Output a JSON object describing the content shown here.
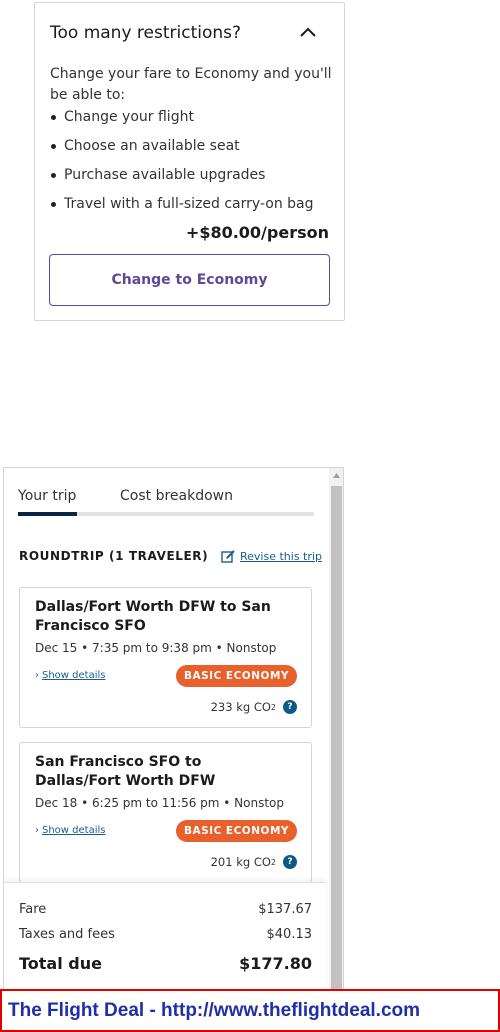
{
  "upsell": {
    "title": "Too many restrictions?",
    "description": "Change your fare to Economy and you'll be able to:",
    "benefits": [
      "Change your flight",
      "Choose an available seat",
      "Purchase available upgrades",
      "Travel with a full-sized carry-on bag"
    ],
    "price": "+$80.00/person",
    "button_label": "Change to Economy",
    "toggle_icon": "chevron-up-icon"
  },
  "trip": {
    "tabs": [
      {
        "label": "Your trip",
        "active": true
      },
      {
        "label": "Cost breakdown",
        "active": false
      }
    ],
    "heading": "ROUNDTRIP (1 TRAVELER)",
    "revise_label": "Revise this trip",
    "revise_icon": "edit-icon",
    "flights": [
      {
        "route": "Dallas/Fort Worth DFW to San Francisco SFO",
        "schedule": "Dec 15 • 7:35 pm to 9:38 pm • Nonstop",
        "details_label": "Show details",
        "badge": "BASIC ECONOMY",
        "co2_value": "233 kg CO",
        "co2_sub": "2"
      },
      {
        "route": "San Francisco SFO to Dallas/Fort Worth DFW",
        "schedule": "Dec 18 • 6:25 pm to 11:56 pm • Nonstop",
        "details_label": "Show details",
        "badge": "BASIC ECONOMY",
        "co2_value": "201 kg CO",
        "co2_sub": "2"
      }
    ],
    "totals": {
      "fare_label": "Fare",
      "fare_value": "$137.67",
      "taxes_label": "Taxes and fees",
      "taxes_value": "$40.13",
      "total_label": "Total due",
      "total_value": "$177.80"
    }
  },
  "watermark": {
    "text": "The Flight Deal - http://www.theflightdeal.com"
  },
  "colors": {
    "brand_purple": "#5c4a95",
    "badge_orange": "#e8612c",
    "link_blue": "#1a5d8f",
    "tab_indicator": "#0a2541",
    "watermark_red": "#e00000",
    "watermark_blue": "#1f2fa8"
  }
}
